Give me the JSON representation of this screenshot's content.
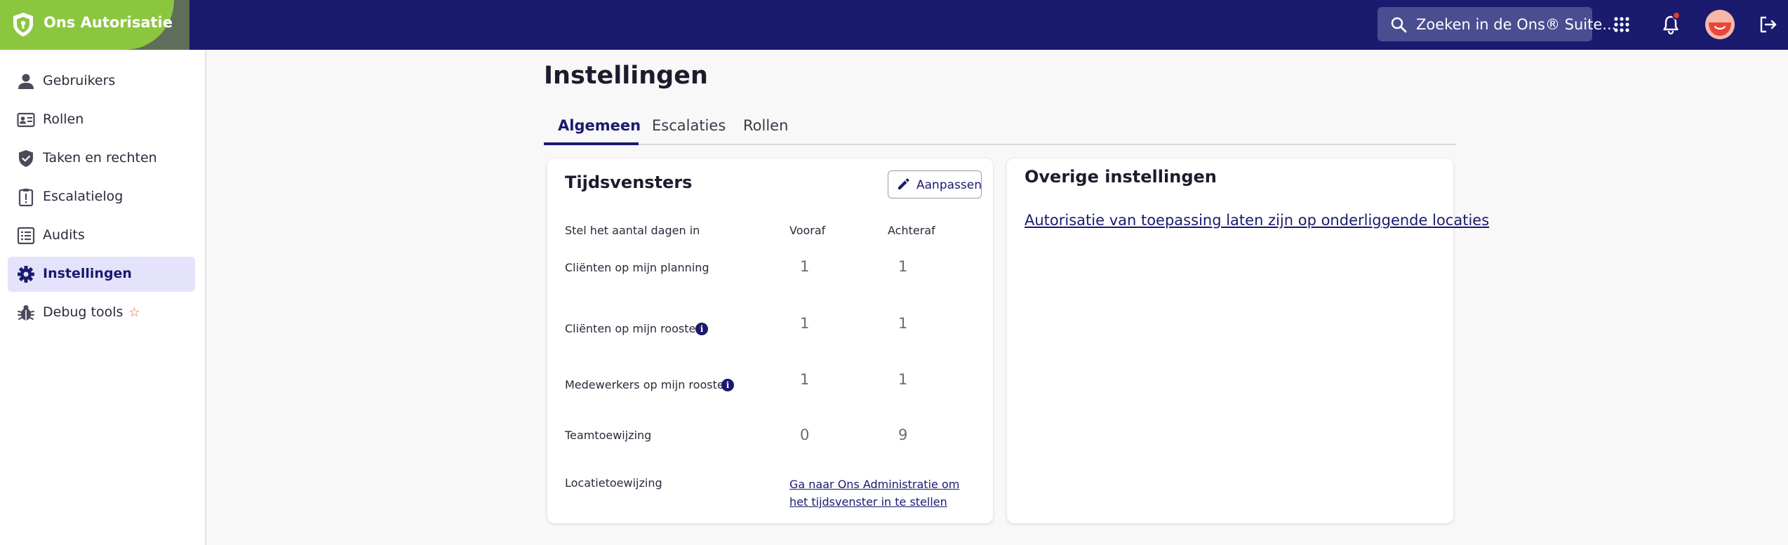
{
  "header": {
    "app_title": "Ons Autorisatie",
    "search_placeholder": "Zoeken in de Ons® Suite...",
    "notification_dot": true
  },
  "colors": {
    "topbar": "#1a1a6e",
    "brand_green": "#8cc63f",
    "accent": "#1a1a6e",
    "active_nav_bg": "#e4e3fb",
    "badge_red": "#e53935",
    "star_orange": "#e8642a"
  },
  "sidebar": {
    "items": [
      {
        "label": "Gebruikers",
        "icon": "person-icon",
        "active": false
      },
      {
        "label": "Rollen",
        "icon": "id-card-icon",
        "active": false
      },
      {
        "label": "Taken en rechten",
        "icon": "shield-check-icon",
        "active": false
      },
      {
        "label": "Escalatielog",
        "icon": "clipboard-alert-icon",
        "active": false
      },
      {
        "label": "Audits",
        "icon": "list-icon",
        "active": false
      },
      {
        "label": "Instellingen",
        "icon": "gear-icon",
        "active": true
      },
      {
        "label": "Debug tools",
        "icon": "bug-icon",
        "active": false,
        "badge": "star-icon"
      }
    ]
  },
  "main": {
    "title": "Instellingen",
    "tabs": [
      {
        "label": "Algemeen",
        "active": true
      },
      {
        "label": "Escalaties",
        "active": false
      },
      {
        "label": "Rollen",
        "active": false
      }
    ]
  },
  "tijdsvensters": {
    "title": "Tijdsvensters",
    "edit_label": "Aanpassen",
    "columns": {
      "label": "Stel het aantal dagen in",
      "before": "Vooraf",
      "after": "Achteraf"
    },
    "rows": [
      {
        "label": "Cliënten op mijn planning",
        "before": "1",
        "after": "1",
        "info": false
      },
      {
        "label": "Cliënten op mijn rooster",
        "before": "1",
        "after": "1",
        "info": true
      },
      {
        "label": "Medewerkers op mijn rooster",
        "before": "1",
        "after": "1",
        "info": true
      },
      {
        "label": "Teamtoewijzing",
        "before": "0",
        "after": "9",
        "info": false
      }
    ],
    "location_row": {
      "label": "Locatietoewijzing",
      "link": "Ga naar Ons Administratie om het tijdsvenster in te stellen"
    }
  },
  "overige": {
    "title": "Overige instellingen",
    "link": "Autorisatie van toepassing laten zijn op onderliggende locaties"
  }
}
